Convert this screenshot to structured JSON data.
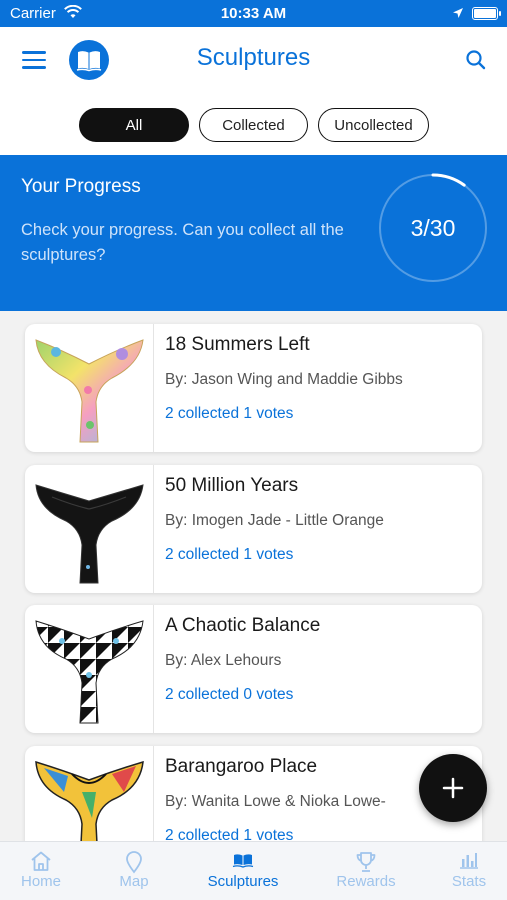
{
  "status_bar": {
    "carrier": "Carrier",
    "time": "10:33 AM"
  },
  "header": {
    "title": "Sculptures",
    "menu_icon": "menu-icon",
    "logo_icon": "book-icon",
    "search_icon": "search-icon"
  },
  "filters": [
    {
      "label": "All",
      "selected": true
    },
    {
      "label": "Collected",
      "selected": false
    },
    {
      "label": "Uncollected",
      "selected": false
    }
  ],
  "progress": {
    "title": "Your Progress",
    "description": "Check your progress. Can you collect all the sculptures?",
    "value_text": "3/30",
    "collected": 3,
    "total": 30
  },
  "sculptures": [
    {
      "name": "18 Summers Left",
      "artist": "By: Jason Wing and Maddie Gibbs",
      "stats": "2 collected  1 votes"
    },
    {
      "name": "50 Million Years",
      "artist": "By: Imogen Jade - Little Orange",
      "stats": "2 collected  1 votes"
    },
    {
      "name": "A Chaotic Balance",
      "artist": "By: Alex Lehours",
      "stats": "2 collected  0 votes"
    },
    {
      "name": "Barangaroo Place",
      "artist": "By: Wanita Lowe & Nioka Lowe-",
      "stats": "2 collected  1 votes"
    }
  ],
  "fab": {
    "icon": "plus-icon"
  },
  "tabs": [
    {
      "label": "Home",
      "icon": "home-icon",
      "active": false
    },
    {
      "label": "Map",
      "icon": "map-pin-icon",
      "active": false
    },
    {
      "label": "Sculptures",
      "icon": "book-icon",
      "active": true
    },
    {
      "label": "Rewards",
      "icon": "trophy-icon",
      "active": false
    },
    {
      "label": "Stats",
      "icon": "bar-chart-icon",
      "active": false
    }
  ],
  "colors": {
    "primary": "#0a72d9",
    "dark": "#111111",
    "tab_inactive": "#9fc4ec"
  }
}
